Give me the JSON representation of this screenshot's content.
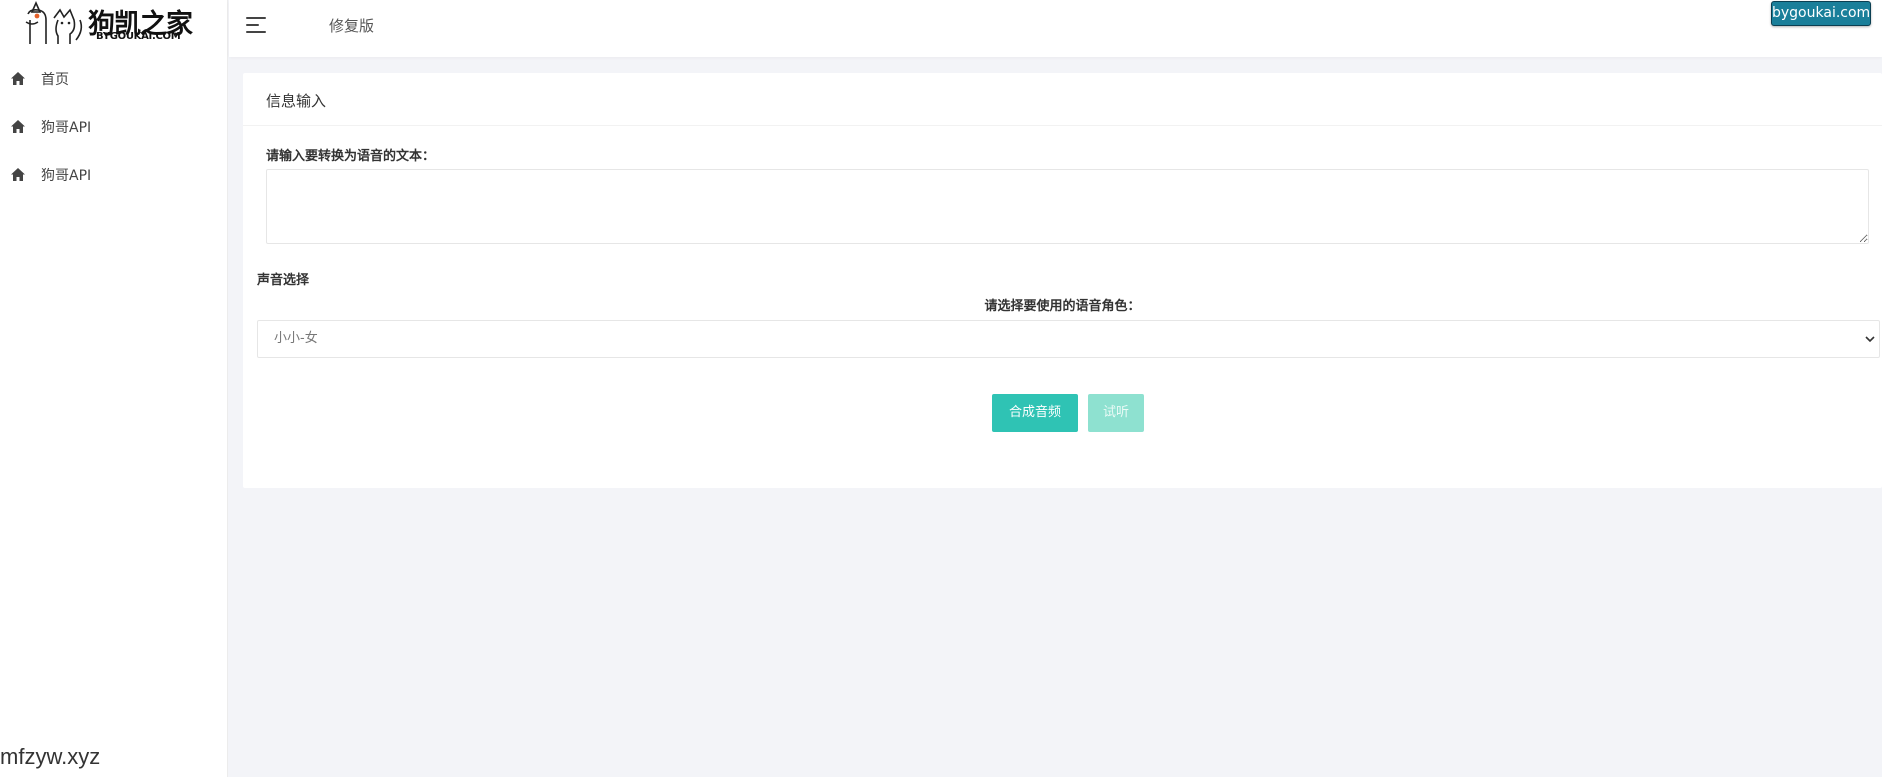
{
  "sidebar": {
    "logo": {
      "title": "狗凯之家",
      "subtitle": "BYGOUKAI.COM"
    },
    "items": [
      {
        "label": "首页",
        "icon": "home-icon"
      },
      {
        "label": "狗哥API",
        "icon": "home-icon"
      },
      {
        "label": "狗哥API",
        "icon": "home-icon"
      }
    ]
  },
  "topbar": {
    "title": "修复版",
    "menu_icon": "hamburger-menu-icon",
    "badge": "bygoukai.com"
  },
  "card": {
    "title": "信息输入",
    "text_label": "请输入要转换为语音的文本：",
    "text_value": "",
    "voice_heading": "声音选择",
    "voice_label": "请选择要使用的语音角色：",
    "voice_selected": "小小-女",
    "synth_button": "合成音频",
    "listen_button": "试听"
  },
  "colors": {
    "accent": "#2fc3b4",
    "accent_disabled": "#8ee1d0",
    "badge": "#1a7f9a"
  },
  "watermark": "mfzyw.xyz"
}
